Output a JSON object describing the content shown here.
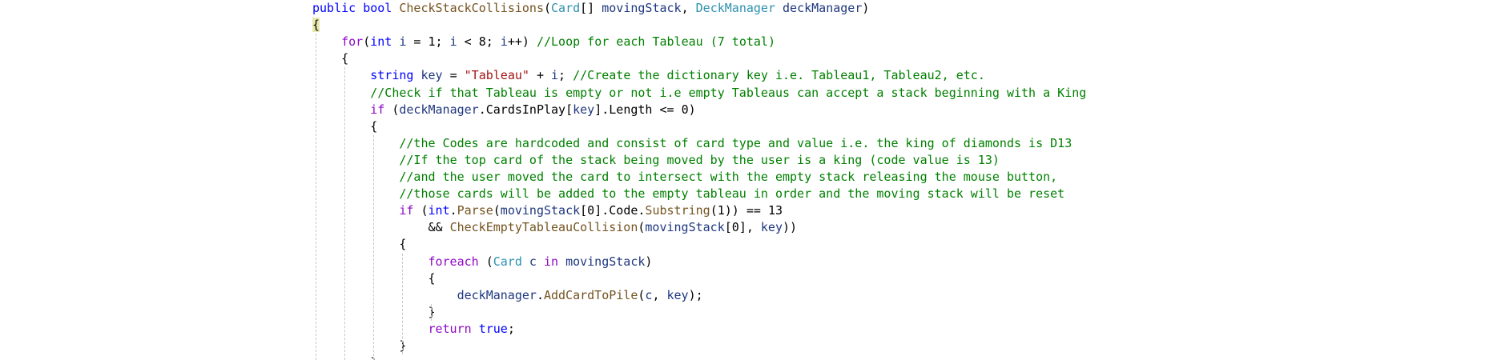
{
  "colors": {
    "keyword": "#0000ff",
    "control": "#8f08c4",
    "type": "#2b91af",
    "method": "#74531f",
    "variable": "#1f377f",
    "string": "#a31515",
    "comment": "#008000",
    "number": "#000000",
    "plain": "#000000",
    "guide": "#c8c8c8",
    "brace_match": "#e8e8ae"
  },
  "code_lines": [
    {
      "indent": 0,
      "tokens": [
        {
          "t": "public",
          "k": "keyword"
        },
        {
          "t": " ",
          "k": "plain"
        },
        {
          "t": "bool",
          "k": "keyword"
        },
        {
          "t": " ",
          "k": "plain"
        },
        {
          "t": "CheckStackCollisions",
          "k": "method"
        },
        {
          "t": "(",
          "k": "plain"
        },
        {
          "t": "Card",
          "k": "type"
        },
        {
          "t": "[] ",
          "k": "plain"
        },
        {
          "t": "movingStack",
          "k": "variable"
        },
        {
          "t": ", ",
          "k": "plain"
        },
        {
          "t": "DeckManager",
          "k": "type"
        },
        {
          "t": " ",
          "k": "plain"
        },
        {
          "t": "deckManager",
          "k": "variable"
        },
        {
          "t": ")",
          "k": "plain"
        }
      ]
    },
    {
      "indent": 0,
      "tokens": [
        {
          "t": "{",
          "k": "brace_match"
        }
      ]
    },
    {
      "indent": 1,
      "tokens": [
        {
          "t": "for",
          "k": "control"
        },
        {
          "t": "(",
          "k": "plain"
        },
        {
          "t": "int",
          "k": "keyword"
        },
        {
          "t": " ",
          "k": "plain"
        },
        {
          "t": "i",
          "k": "variable"
        },
        {
          "t": " = ",
          "k": "plain"
        },
        {
          "t": "1",
          "k": "number"
        },
        {
          "t": "; ",
          "k": "plain"
        },
        {
          "t": "i",
          "k": "variable"
        },
        {
          "t": " < ",
          "k": "plain"
        },
        {
          "t": "8",
          "k": "number"
        },
        {
          "t": "; ",
          "k": "plain"
        },
        {
          "t": "i",
          "k": "variable"
        },
        {
          "t": "++) ",
          "k": "plain"
        },
        {
          "t": "//Loop for each Tableau (7 total)",
          "k": "comment"
        }
      ]
    },
    {
      "indent": 1,
      "tokens": [
        {
          "t": "{",
          "k": "plain"
        }
      ]
    },
    {
      "indent": 2,
      "tokens": [
        {
          "t": "string",
          "k": "keyword"
        },
        {
          "t": " ",
          "k": "plain"
        },
        {
          "t": "key",
          "k": "variable"
        },
        {
          "t": " = ",
          "k": "plain"
        },
        {
          "t": "\"Tableau\"",
          "k": "string"
        },
        {
          "t": " + ",
          "k": "plain"
        },
        {
          "t": "i",
          "k": "variable"
        },
        {
          "t": "; ",
          "k": "plain"
        },
        {
          "t": "//Create the dictionary key i.e. Tableau1, Tableau2, etc.",
          "k": "comment"
        }
      ]
    },
    {
      "indent": 2,
      "tokens": [
        {
          "t": "//Check if that Tableau is empty or not i.e empty Tableaus can accept a stack beginning with a King",
          "k": "comment"
        }
      ]
    },
    {
      "indent": 2,
      "tokens": [
        {
          "t": "if",
          "k": "control"
        },
        {
          "t": " (",
          "k": "plain"
        },
        {
          "t": "deckManager",
          "k": "variable"
        },
        {
          "t": ".CardsInPlay[",
          "k": "plain"
        },
        {
          "t": "key",
          "k": "variable"
        },
        {
          "t": "].Length <= ",
          "k": "plain"
        },
        {
          "t": "0",
          "k": "number"
        },
        {
          "t": ")",
          "k": "plain"
        }
      ]
    },
    {
      "indent": 2,
      "tokens": [
        {
          "t": "{",
          "k": "plain"
        }
      ]
    },
    {
      "indent": 3,
      "tokens": [
        {
          "t": "//the Codes are hardcoded and consist of card type and value i.e. the king of diamonds is D13",
          "k": "comment"
        }
      ]
    },
    {
      "indent": 3,
      "tokens": [
        {
          "t": "//If the top card of the stack being moved by the user is a king (code value is 13)",
          "k": "comment"
        }
      ]
    },
    {
      "indent": 3,
      "tokens": [
        {
          "t": "//and the user moved the card to intersect with the empty stack releasing the mouse button,",
          "k": "comment"
        }
      ]
    },
    {
      "indent": 3,
      "tokens": [
        {
          "t": "//those cards will be added to the empty tableau in order and the moving stack will be reset",
          "k": "comment"
        }
      ]
    },
    {
      "indent": 3,
      "tokens": [
        {
          "t": "if",
          "k": "control"
        },
        {
          "t": " (",
          "k": "plain"
        },
        {
          "t": "int",
          "k": "keyword"
        },
        {
          "t": ".",
          "k": "plain"
        },
        {
          "t": "Parse",
          "k": "method"
        },
        {
          "t": "(",
          "k": "plain"
        },
        {
          "t": "movingStack",
          "k": "variable"
        },
        {
          "t": "[",
          "k": "plain"
        },
        {
          "t": "0",
          "k": "number"
        },
        {
          "t": "].Code.",
          "k": "plain"
        },
        {
          "t": "Substring",
          "k": "method"
        },
        {
          "t": "(",
          "k": "plain"
        },
        {
          "t": "1",
          "k": "number"
        },
        {
          "t": ")) == ",
          "k": "plain"
        },
        {
          "t": "13",
          "k": "number"
        }
      ]
    },
    {
      "indent": 4,
      "tokens": [
        {
          "t": "&& ",
          "k": "plain"
        },
        {
          "t": "CheckEmptyTableauCollision",
          "k": "method"
        },
        {
          "t": "(",
          "k": "plain"
        },
        {
          "t": "movingStack",
          "k": "variable"
        },
        {
          "t": "[",
          "k": "plain"
        },
        {
          "t": "0",
          "k": "number"
        },
        {
          "t": "], ",
          "k": "plain"
        },
        {
          "t": "key",
          "k": "variable"
        },
        {
          "t": "))",
          "k": "plain"
        }
      ]
    },
    {
      "indent": 3,
      "tokens": [
        {
          "t": "{",
          "k": "plain"
        }
      ]
    },
    {
      "indent": 4,
      "tokens": [
        {
          "t": "foreach",
          "k": "control"
        },
        {
          "t": " (",
          "k": "plain"
        },
        {
          "t": "Card",
          "k": "type"
        },
        {
          "t": " ",
          "k": "plain"
        },
        {
          "t": "c",
          "k": "variable"
        },
        {
          "t": " ",
          "k": "plain"
        },
        {
          "t": "in",
          "k": "control"
        },
        {
          "t": " ",
          "k": "plain"
        },
        {
          "t": "movingStack",
          "k": "variable"
        },
        {
          "t": ")",
          "k": "plain"
        }
      ]
    },
    {
      "indent": 4,
      "tokens": [
        {
          "t": "{",
          "k": "plain"
        }
      ]
    },
    {
      "indent": 5,
      "tokens": [
        {
          "t": "deckManager",
          "k": "variable"
        },
        {
          "t": ".",
          "k": "plain"
        },
        {
          "t": "AddCardToPile",
          "k": "method"
        },
        {
          "t": "(",
          "k": "plain"
        },
        {
          "t": "c",
          "k": "variable"
        },
        {
          "t": ", ",
          "k": "plain"
        },
        {
          "t": "key",
          "k": "variable"
        },
        {
          "t": ");",
          "k": "plain"
        }
      ]
    },
    {
      "indent": 4,
      "tokens": [
        {
          "t": "}",
          "k": "plain"
        }
      ]
    },
    {
      "indent": 4,
      "tokens": [
        {
          "t": "return",
          "k": "control"
        },
        {
          "t": " ",
          "k": "plain"
        },
        {
          "t": "true",
          "k": "keyword"
        },
        {
          "t": ";",
          "k": "plain"
        }
      ]
    },
    {
      "indent": 3,
      "tokens": [
        {
          "t": "}",
          "k": "plain"
        }
      ]
    },
    {
      "indent": 2,
      "tokens": [
        {
          "t": "}",
          "k": "plain"
        }
      ]
    }
  ]
}
